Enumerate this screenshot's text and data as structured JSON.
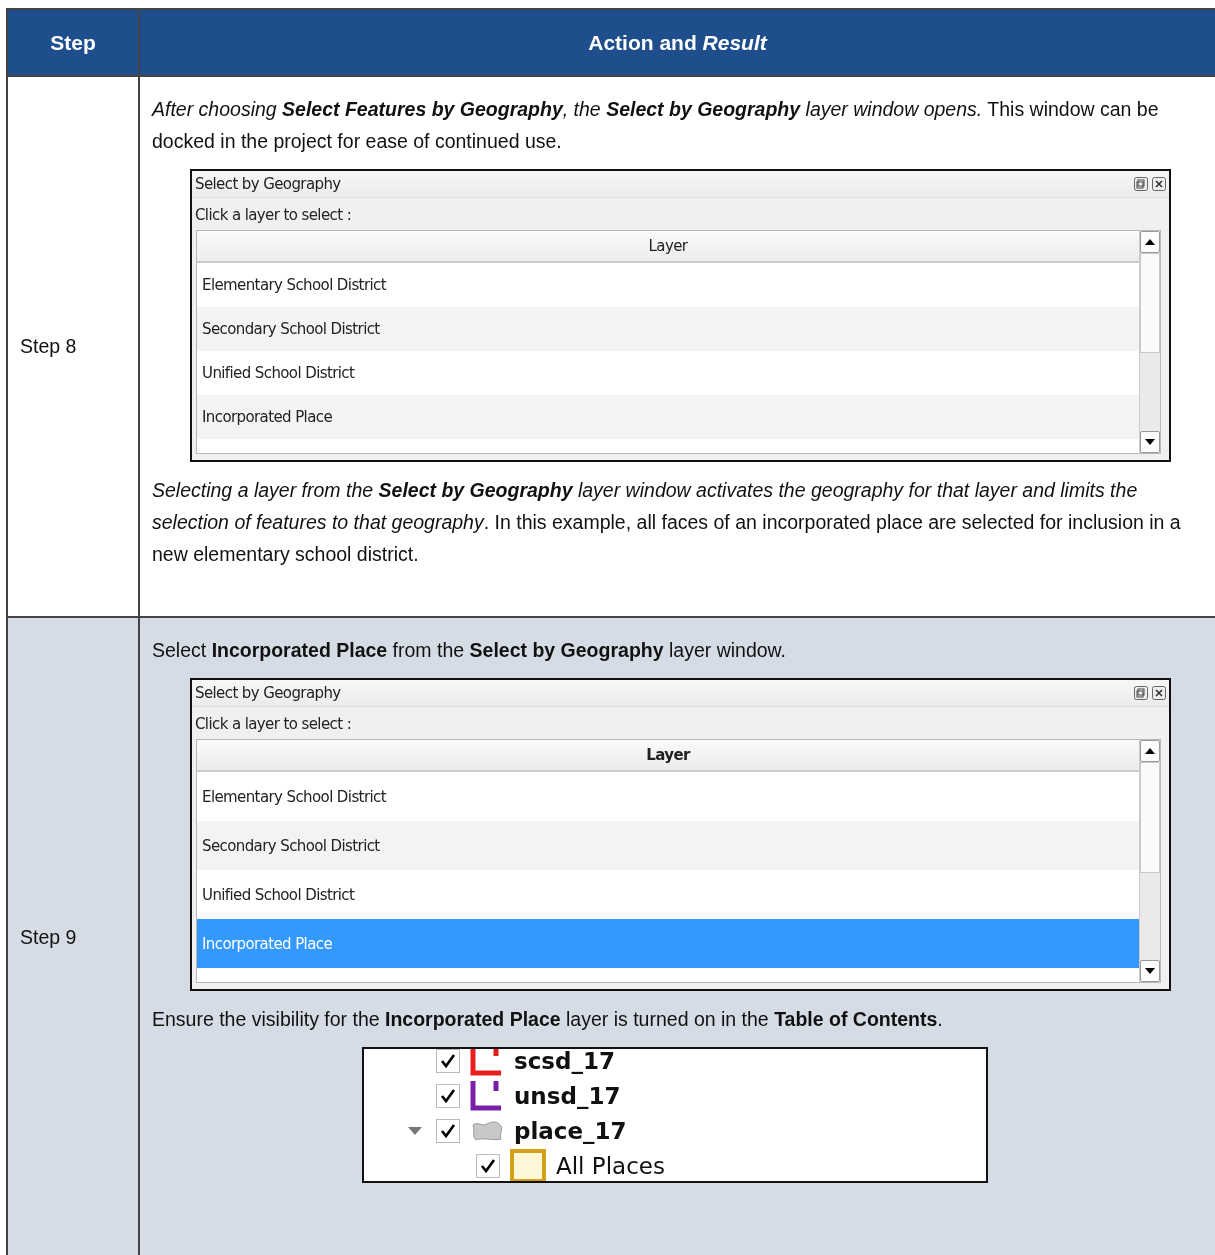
{
  "table": {
    "columns": [
      "Step",
      "Action and *Result*"
    ],
    "rows": [
      {
        "step": "Step 8",
        "blocks": [
          {
            "kind": "paragraph",
            "segments": [
              {
                "text": "After choosing ",
                "bold": false,
                "italic": true
              },
              {
                "text": "Select Features by Geography",
                "bold": true,
                "italic": true
              },
              {
                "text": ", the ",
                "bold": false,
                "italic": true
              },
              {
                "text": "Select by Geography",
                "bold": true,
                "italic": true
              },
              {
                "text": " layer window opens.",
                "bold": false,
                "italic": true
              },
              {
                "text": " This window can be docked in the project for ease of continued use.",
                "bold": false,
                "italic": false
              }
            ]
          },
          {
            "kind": "window",
            "title": "Select by Geography",
            "prompt": "Click a layer to select :",
            "header": "Layer",
            "header_bold": false,
            "layers": [
              {
                "label": "Elementary School District",
                "selected": false
              },
              {
                "label": "Secondary School District",
                "selected": false
              },
              {
                "label": "Unified School District",
                "selected": false
              },
              {
                "label": "Incorporated Place",
                "selected": false
              }
            ]
          },
          {
            "kind": "paragraph",
            "segments": [
              {
                "text": "Selecting a layer from the ",
                "bold": false,
                "italic": true
              },
              {
                "text": "Select by Geography",
                "bold": true,
                "italic": true
              },
              {
                "text": " layer window activates the geography for that layer and limits the selection of features to that geography",
                "bold": false,
                "italic": true
              },
              {
                "text": ". In this example, all faces of an incorporated place are selected for inclusion in a new elementary school district.",
                "bold": false,
                "italic": false
              }
            ]
          }
        ]
      },
      {
        "step": "Step 9",
        "blocks": [
          {
            "kind": "paragraph",
            "segments": [
              {
                "text": "Select ",
                "bold": false,
                "italic": false
              },
              {
                "text": "Incorporated Place",
                "bold": true,
                "italic": false
              },
              {
                "text": " from the ",
                "bold": false,
                "italic": false
              },
              {
                "text": "Select by Geography",
                "bold": true,
                "italic": false
              },
              {
                "text": " layer window.",
                "bold": false,
                "italic": false
              }
            ]
          },
          {
            "kind": "window",
            "title": "Select by Geography",
            "prompt": "Click a layer to select :",
            "header": "Layer",
            "header_bold": true,
            "layers": [
              {
                "label": "Elementary School District",
                "selected": false
              },
              {
                "label": "Secondary School District",
                "selected": false
              },
              {
                "label": "Unified School District",
                "selected": false
              },
              {
                "label": "Incorporated Place",
                "selected": true
              }
            ]
          },
          {
            "kind": "paragraph",
            "segments": [
              {
                "text": "Ensure the visibility for the ",
                "bold": false,
                "italic": false
              },
              {
                "text": "Incorporated Place",
                "bold": true,
                "italic": false
              },
              {
                "text": " layer is turned on in the ",
                "bold": false,
                "italic": false
              },
              {
                "text": "Table of Contents",
                "bold": true,
                "italic": false
              },
              {
                "text": ".",
                "bold": false,
                "italic": false
              }
            ]
          },
          {
            "kind": "toc",
            "items": [
              {
                "label": "scsd_17",
                "kind": "line",
                "color": "#e8201c",
                "checked": true
              },
              {
                "label": "unsd_17",
                "kind": "line",
                "color": "#7a1fa8",
                "checked": true
              },
              {
                "label": "place_17",
                "kind": "polygon",
                "color": "#c8c8c8",
                "checked": true,
                "expanded": true,
                "children": [
                  {
                    "label": "All Places",
                    "kind": "fill",
                    "color": "#d4a017",
                    "checked": true
                  }
                ]
              }
            ]
          }
        ]
      }
    ]
  }
}
